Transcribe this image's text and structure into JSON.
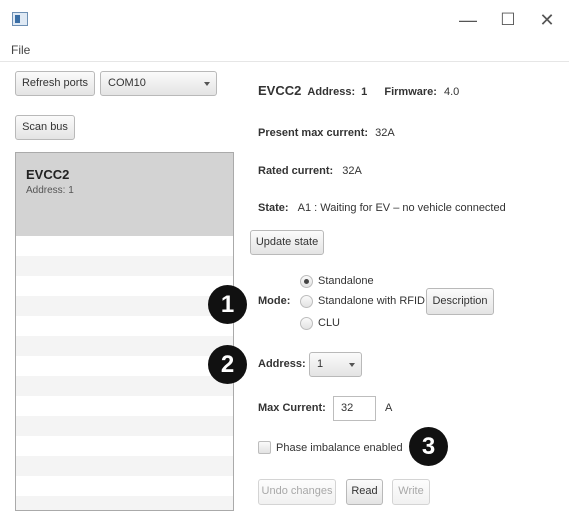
{
  "window": {
    "icons": {
      "app": "app-window-icon",
      "minimize": "minimize-icon",
      "maximize": "maximize-icon",
      "close": "close-icon"
    },
    "minimize_glyph": "—",
    "maximize_glyph": "☐",
    "close_glyph": "✕"
  },
  "menu": {
    "file": "File"
  },
  "sidebar": {
    "refresh_label": "Refresh ports",
    "port_selected": "COM10",
    "scan_label": "Scan bus",
    "devices": [
      {
        "name": "EVCC2",
        "address": "Address: 1"
      }
    ]
  },
  "header": {
    "device": "EVCC2",
    "address_label": "Address:",
    "address_value": "1",
    "firmware_label": "Firmware:",
    "firmware_value": "4.0"
  },
  "info": {
    "present_label": "Present max current:",
    "present_value": "32A",
    "rated_label": "Rated current:",
    "rated_value": "32A",
    "state_label": "State:",
    "state_value": "A1 : Waiting for EV – no vehicle connected",
    "update_label": "Update state"
  },
  "mode": {
    "label": "Mode:",
    "options": [
      "Standalone",
      "Standalone with RFID",
      "CLU"
    ],
    "selected": "Standalone",
    "description_label": "Description"
  },
  "address": {
    "label": "Address:",
    "value": "1"
  },
  "current": {
    "label": "Max Current:",
    "value": "32",
    "unit": "A"
  },
  "phase": {
    "label": "Phase imbalance enabled",
    "checked": false
  },
  "actions": {
    "undo": "Undo changes",
    "read": "Read",
    "write": "Write"
  },
  "markers": [
    "1",
    "2",
    "3"
  ]
}
